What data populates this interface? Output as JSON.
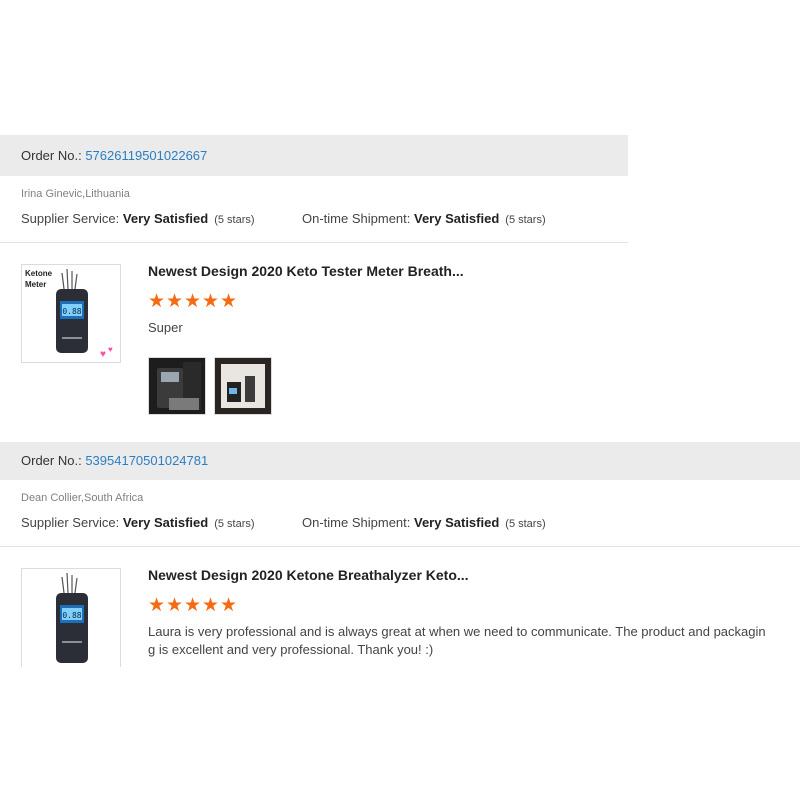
{
  "feedback": [
    {
      "order_label": "Order No.:",
      "order_no": "57626119501022667",
      "buyer": "Irina Ginevic,Lithuania",
      "supplier_label": "Supplier Service:",
      "supplier_value": "Very Satisfied",
      "supplier_stars": "(5 stars)",
      "shipment_label": "On-time Shipment:",
      "shipment_value": "Very Satisfied",
      "shipment_stars": "(5 stars)",
      "product_title": "Newest Design 2020 Keto Tester Meter Breath...",
      "thumb_caption_1": "Ketone",
      "thumb_caption_2": "Meter",
      "rating": 5,
      "review": "Super",
      "photos": [
        "review-photo-1",
        "review-photo-2"
      ]
    },
    {
      "order_label": "Order No.:",
      "order_no": "53954170501024781",
      "buyer": "Dean Collier,South Africa",
      "supplier_label": "Supplier Service:",
      "supplier_value": "Very Satisfied",
      "supplier_stars": "(5 stars)",
      "shipment_label": "On-time Shipment:",
      "shipment_value": "Very Satisfied",
      "shipment_stars": "(5 stars)",
      "product_title": "Newest Design 2020 Ketone Breathalyzer Keto...",
      "rating": 5,
      "review_line1": "Laura is very professional and is always great at when we need to communicate. The product and packagin",
      "review_line2": "g is excellent and very professional. Thank you! :)"
    }
  ],
  "colors": {
    "star": "#f46b16",
    "link": "#2a7ec2",
    "header_bg": "#ebebeb"
  },
  "icons": {
    "star": "star-icon",
    "device": "breathalyzer-image"
  }
}
